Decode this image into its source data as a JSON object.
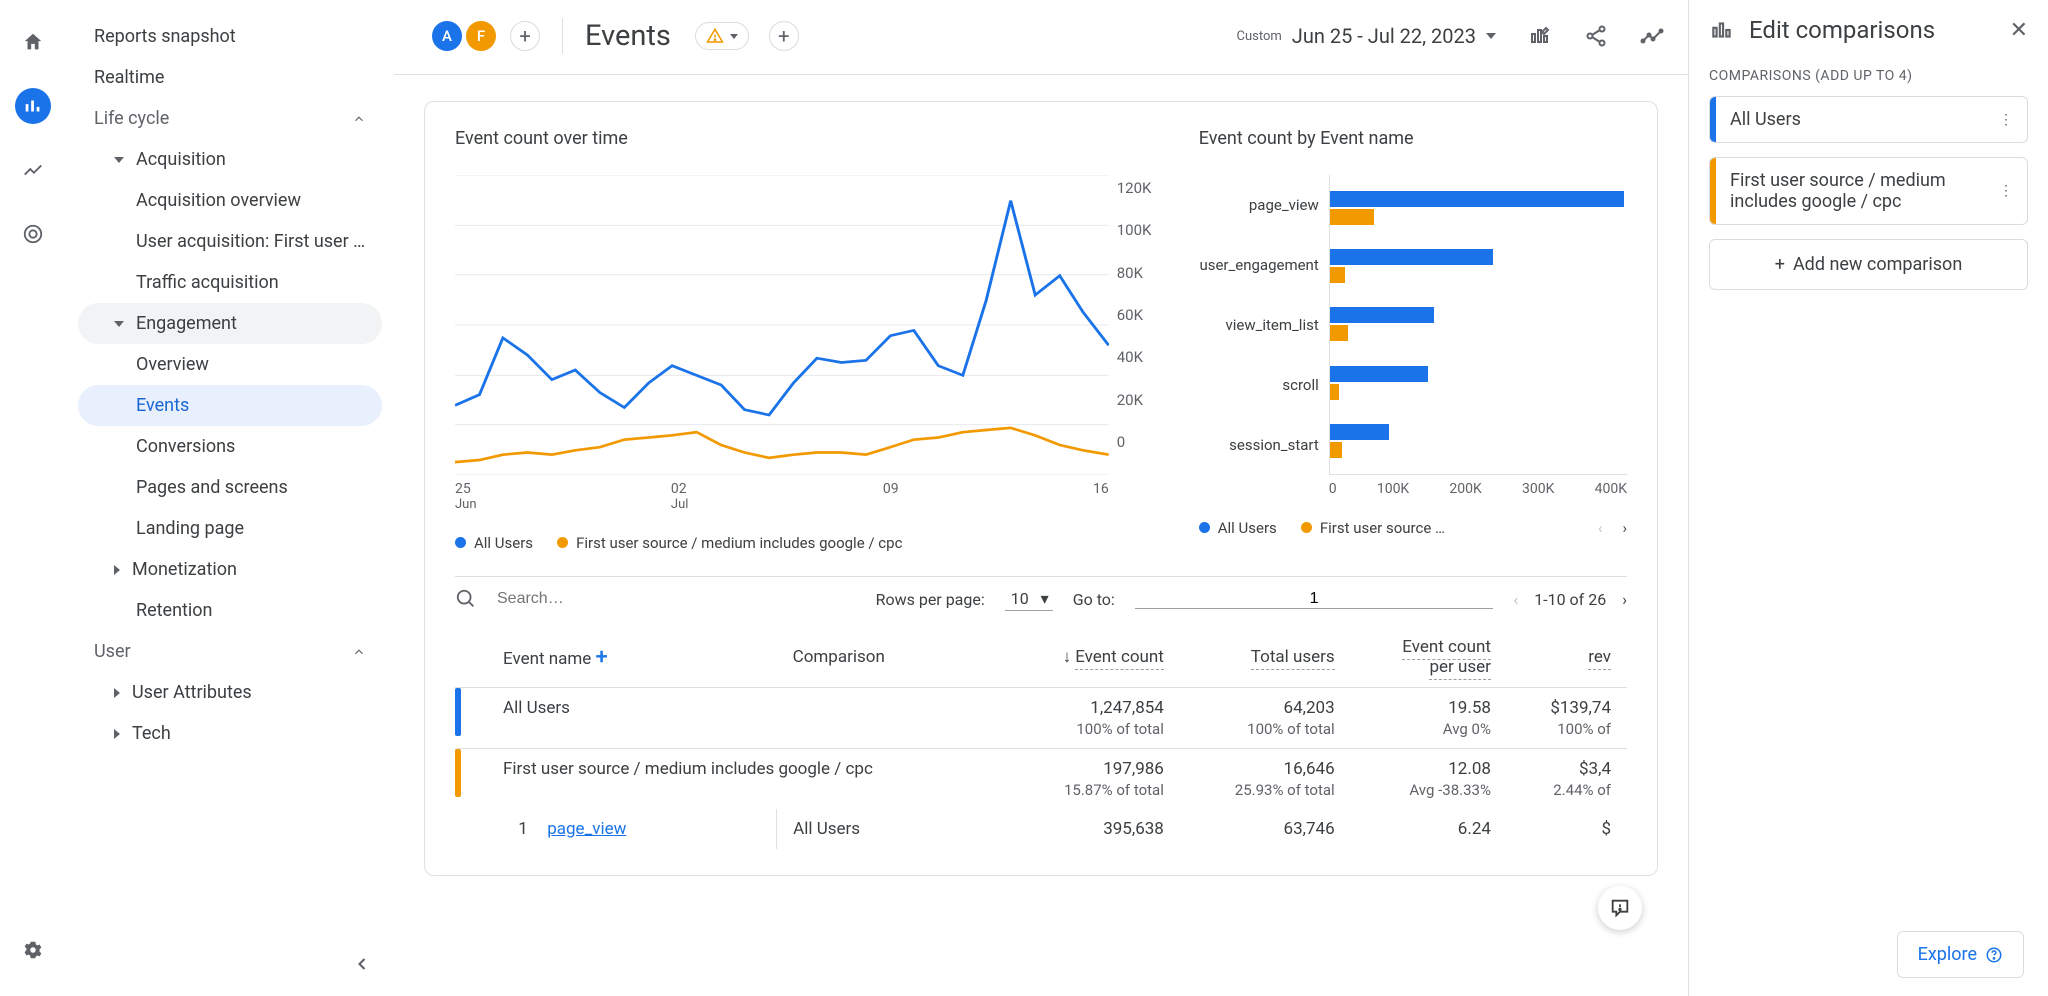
{
  "sidebar": {
    "reports_snapshot": "Reports snapshot",
    "realtime": "Realtime",
    "life_cycle": "Life cycle",
    "acquisition": "Acquisition",
    "acquisition_overview": "Acquisition overview",
    "user_acquisition": "User acquisition: First user …",
    "traffic_acquisition": "Traffic acquisition",
    "engagement": "Engagement",
    "overview": "Overview",
    "events": "Events",
    "conversions": "Conversions",
    "pages_screens": "Pages and screens",
    "landing_page": "Landing page",
    "monetization": "Monetization",
    "retention": "Retention",
    "user": "User",
    "user_attributes": "User Attributes",
    "tech": "Tech"
  },
  "header": {
    "chip_a": "A",
    "chip_f": "F",
    "title": "Events",
    "custom": "Custom",
    "dates": "Jun 25 - Jul 22, 2023"
  },
  "chart1": {
    "title": "Event count over time",
    "legend_a": "All Users",
    "legend_b": "First user source / medium includes google / cpc",
    "yticks": [
      "120K",
      "100K",
      "80K",
      "60K",
      "40K",
      "20K",
      "0"
    ],
    "xticks": [
      {
        "top": "25",
        "sub": "Jun"
      },
      {
        "top": "02",
        "sub": "Jul"
      },
      {
        "top": "09",
        "sub": ""
      },
      {
        "top": "16",
        "sub": ""
      }
    ]
  },
  "chart2": {
    "title": "Event count by Event name",
    "rows": [
      "page_view",
      "user_engagement",
      "view_item_list",
      "scroll",
      "session_start"
    ],
    "xticks": [
      "0",
      "100K",
      "200K",
      "300K",
      "400K"
    ],
    "legend_a": "All Users",
    "legend_b": "First user source / m…"
  },
  "table": {
    "search_placeholder": "Search…",
    "rows_per_page": "Rows per page:",
    "rpp_value": "10",
    "go_to": "Go to:",
    "goto_value": "1",
    "pager": "1-10 of 26",
    "cols": {
      "event_name": "Event name",
      "comparison": "Comparison",
      "event_count": "Event count",
      "total_users": "Total users",
      "ecpu1": "Event count",
      "ecpu2": "per user",
      "rev": "rev"
    },
    "summary": [
      {
        "label": "All Users",
        "event_count": "1,247,854",
        "event_count_sub": "100% of total",
        "total_users": "64,203",
        "total_users_sub": "100% of total",
        "ecpu": "19.58",
        "ecpu_sub": "Avg 0%",
        "rev": "$139,74",
        "rev_sub": "100% of"
      },
      {
        "label": "First user source / medium includes google / cpc",
        "event_count": "197,986",
        "event_count_sub": "15.87% of total",
        "total_users": "16,646",
        "total_users_sub": "25.93% of total",
        "ecpu": "12.08",
        "ecpu_sub": "Avg -38.33%",
        "rev": "$3,4",
        "rev_sub": "2.44% of"
      }
    ],
    "rows": [
      {
        "n": "1",
        "name": "page_view",
        "comp": "All Users",
        "ec": "395,638",
        "tu": "63,746",
        "ecpu": "6.24",
        "rev": "$"
      }
    ]
  },
  "right": {
    "title": "Edit comparisons",
    "sub": "COMPARISONS (ADD UP TO 4)",
    "c1": "All Users",
    "c2": "First user source / medium includes google / cpc",
    "add": "Add new comparison"
  },
  "explore": "Explore",
  "chart_data": [
    {
      "type": "line",
      "title": "Event count over time",
      "xlabel": "",
      "ylabel": "",
      "ylim": [
        0,
        120000
      ],
      "x": [
        "Jun 25",
        "Jun 26",
        "Jun 27",
        "Jun 28",
        "Jun 29",
        "Jun 30",
        "Jul 01",
        "Jul 02",
        "Jul 03",
        "Jul 04",
        "Jul 05",
        "Jul 06",
        "Jul 07",
        "Jul 08",
        "Jul 09",
        "Jul 10",
        "Jul 11",
        "Jul 12",
        "Jul 13",
        "Jul 14",
        "Jul 15",
        "Jul 16",
        "Jul 17",
        "Jul 18",
        "Jul 19",
        "Jul 20",
        "Jul 21",
        "Jul 22"
      ],
      "series": [
        {
          "name": "All Users",
          "values": [
            28000,
            32000,
            55000,
            48000,
            38000,
            42000,
            33000,
            27000,
            37000,
            44000,
            40000,
            36000,
            26000,
            24000,
            37000,
            47000,
            45000,
            46000,
            56000,
            58000,
            44000,
            40000,
            70000,
            110000,
            72000,
            80000,
            65000,
            52000
          ]
        },
        {
          "name": "First user source / medium includes google / cpc",
          "values": [
            5000,
            6000,
            8000,
            9000,
            8000,
            10000,
            11000,
            14000,
            15000,
            16000,
            17000,
            12000,
            9000,
            7000,
            8000,
            9000,
            9000,
            8000,
            11000,
            14000,
            15000,
            17000,
            18000,
            19000,
            16000,
            12000,
            10000,
            8000
          ]
        }
      ]
    },
    {
      "type": "bar",
      "title": "Event count by Event name",
      "orientation": "horizontal",
      "xlim": [
        0,
        400000
      ],
      "categories": [
        "page_view",
        "user_engagement",
        "view_item_list",
        "scroll",
        "session_start"
      ],
      "series": [
        {
          "name": "All Users",
          "values": [
            395000,
            220000,
            140000,
            130000,
            80000
          ]
        },
        {
          "name": "First user source / medium includes google / cpc",
          "values": [
            60000,
            20000,
            25000,
            12000,
            15000
          ]
        }
      ]
    }
  ]
}
